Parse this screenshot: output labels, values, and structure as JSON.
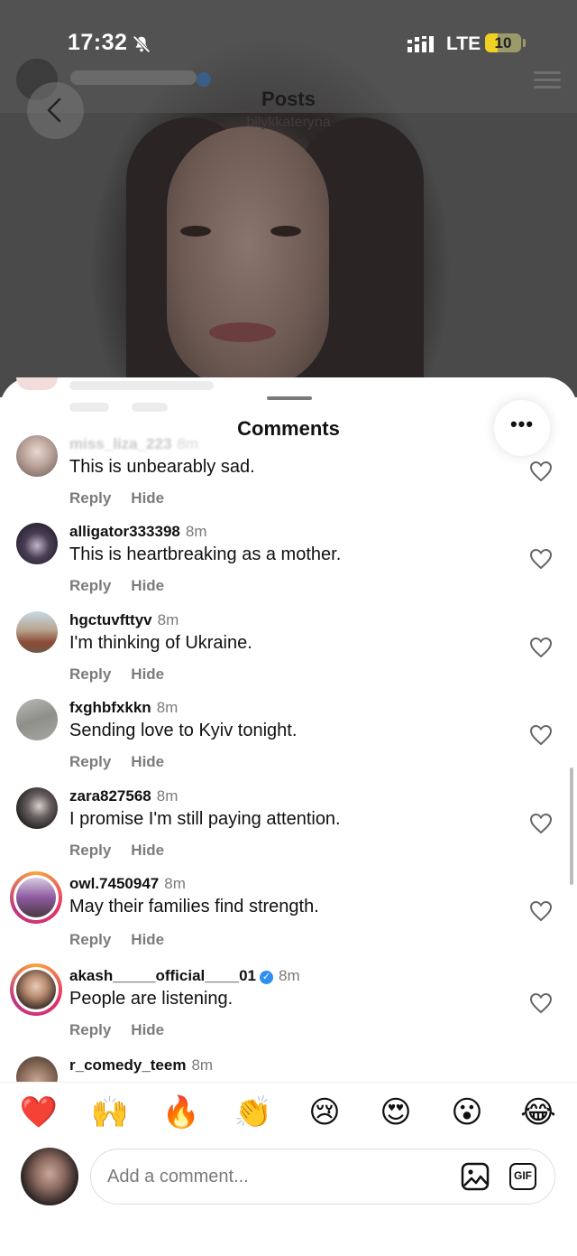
{
  "status_bar": {
    "time": "17:32",
    "network": "LTE",
    "battery": "10",
    "icons": [
      "bell-slash-icon",
      "signal-icon",
      "battery-icon"
    ]
  },
  "nav": {
    "title": "Posts",
    "subtitle": "bilykkateryna",
    "back_icon": "chevron-left-icon"
  },
  "sheet": {
    "title": "Comments",
    "more_label": "•••"
  },
  "comments": [
    {
      "username": "miss_liza_223",
      "time": "8m",
      "text": "This is unbearably sad.",
      "reply": "Reply",
      "hide": "Hide",
      "verified": false
    },
    {
      "username": "alligator333398",
      "time": "8m",
      "text": "This is heartbreaking as a mother.",
      "reply": "Reply",
      "hide": "Hide",
      "verified": false
    },
    {
      "username": "hgctuvfttyv",
      "time": "8m",
      "text": "I'm thinking of Ukraine.",
      "reply": "Reply",
      "hide": "Hide",
      "verified": false
    },
    {
      "username": "fxghbfxkkn",
      "time": "8m",
      "text": "Sending love to Kyiv tonight.",
      "reply": "Reply",
      "hide": "Hide",
      "verified": false
    },
    {
      "username": "zara827568",
      "time": "8m",
      "text": "I promise I'm still paying attention.",
      "reply": "Reply",
      "hide": "Hide",
      "verified": false
    },
    {
      "username": "owl.7450947",
      "time": "8m",
      "text": "May their families find strength.",
      "reply": "Reply",
      "hide": "Hide",
      "verified": false
    },
    {
      "username": "akash_____official____01",
      "time": "8m",
      "text": "People are listening.",
      "reply": "Reply",
      "hide": "Hide",
      "verified": true
    },
    {
      "username": "r_comedy_teem",
      "time": "8m",
      "text": "",
      "reply": "",
      "hide": "",
      "verified": false
    }
  ],
  "emojis": [
    "❤️",
    "🙌",
    "🔥",
    "👏",
    "😢",
    "😍",
    "😮",
    "😂"
  ],
  "composer": {
    "placeholder": "Add a comment...",
    "gif_label": "GIF"
  },
  "colors": {
    "accent_blue": "#2f8ff0",
    "story_ring": "#e1306c",
    "muted_text": "#7c7c7c"
  }
}
